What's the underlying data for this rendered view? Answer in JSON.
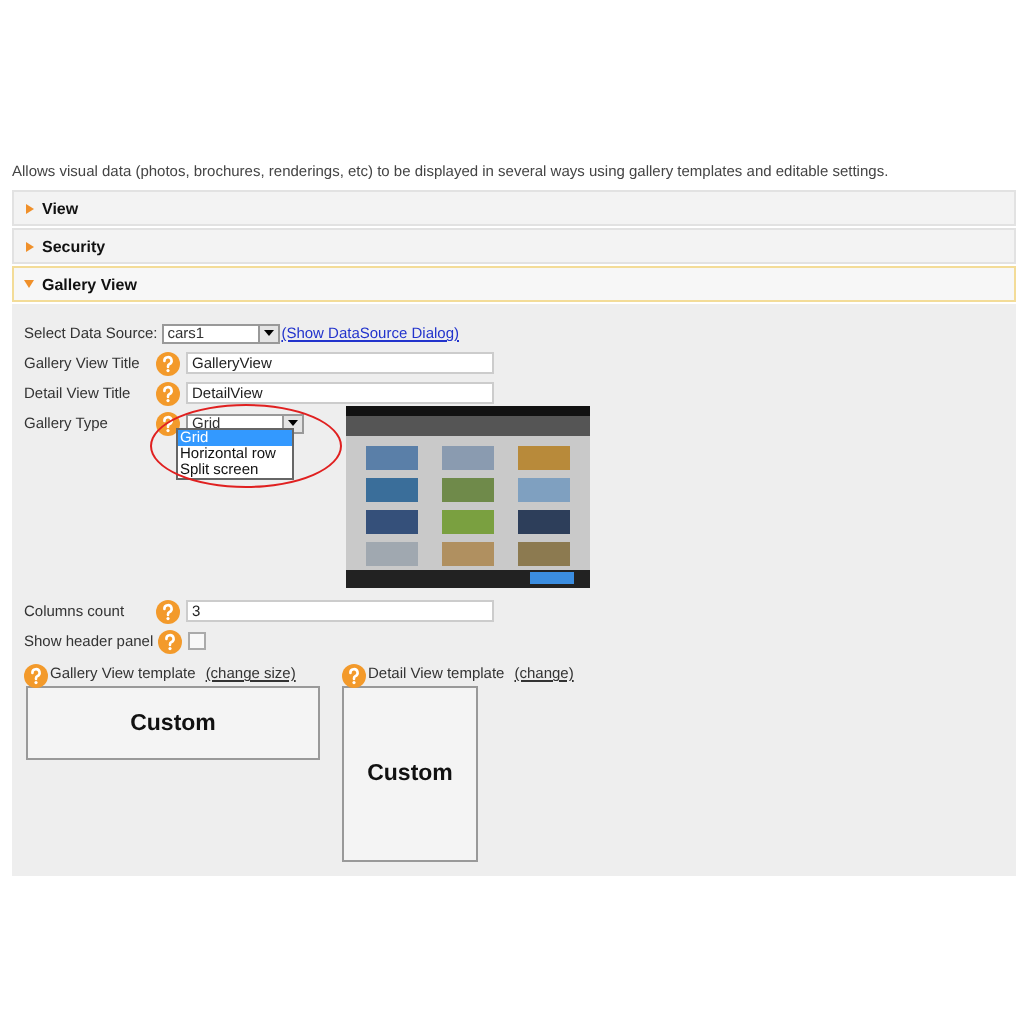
{
  "description": "Allows visual data (photos, brochures, renderings, etc) to be displayed in several ways using gallery templates and editable settings.",
  "sections": [
    {
      "title": "View",
      "expanded": false
    },
    {
      "title": "Security",
      "expanded": false
    },
    {
      "title": "Gallery View",
      "expanded": true
    }
  ],
  "data_source": {
    "label": "Select Data Source:",
    "value": "cars1",
    "link": "(Show DataSource Dialog)"
  },
  "fields": [
    {
      "label": "Gallery View Title",
      "value": "GalleryView"
    },
    {
      "label": "Detail View Title",
      "value": "DetailView"
    }
  ],
  "gallery_type": {
    "label": "Gallery Type",
    "value": "Grid",
    "options": [
      {
        "label": "Grid",
        "selected": true
      },
      {
        "label": "Horizontal row",
        "selected": false
      },
      {
        "label": "Split screen",
        "selected": false
      }
    ]
  },
  "columns_count": {
    "label": "Columns count",
    "value": "3"
  },
  "show_header_panel": {
    "label": "Show header panel",
    "checked": false
  },
  "templates": [
    {
      "label": "Gallery View template",
      "link": "(change size)",
      "value": "Custom",
      "kind": "wide"
    },
    {
      "label": "Detail View template",
      "link": "(change)",
      "value": "Custom",
      "kind": "tall"
    }
  ]
}
